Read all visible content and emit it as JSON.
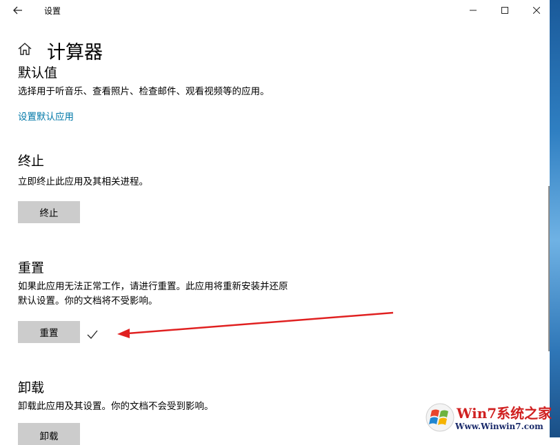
{
  "window": {
    "title": "设置",
    "back_icon": "arrow-left-icon",
    "minimize_icon": "minimize-icon",
    "maximize_icon": "maximize-icon",
    "close_icon": "close-icon"
  },
  "page": {
    "title": "计算器",
    "home_icon": "home-icon"
  },
  "sections": {
    "defaults": {
      "heading": "默认值",
      "description": "选择用于听音乐、查看照片、检查邮件、观看视频等的应用。",
      "link": "设置默认应用"
    },
    "terminate": {
      "heading": "终止",
      "description": "立即终止此应用及其相关进程。",
      "button": "终止"
    },
    "reset": {
      "heading": "重置",
      "description_line1": "如果此应用无法正常工作，请进行重置。此应用将重新安装并还原",
      "description_line2": "默认设置。你的文档将不受影响。",
      "button": "重置",
      "status_icon": "checkmark-icon"
    },
    "uninstall": {
      "heading": "卸载",
      "description": "卸载此应用及其设置。你的文档不会受到影响。",
      "button": "卸载"
    }
  },
  "annotation": {
    "arrow_color": "#e02020"
  },
  "watermark": {
    "brand": "Win7系统之家",
    "url": "Www.Winwin7.com"
  },
  "colors": {
    "link": "#0078a8",
    "button_bg": "#cccccc"
  }
}
